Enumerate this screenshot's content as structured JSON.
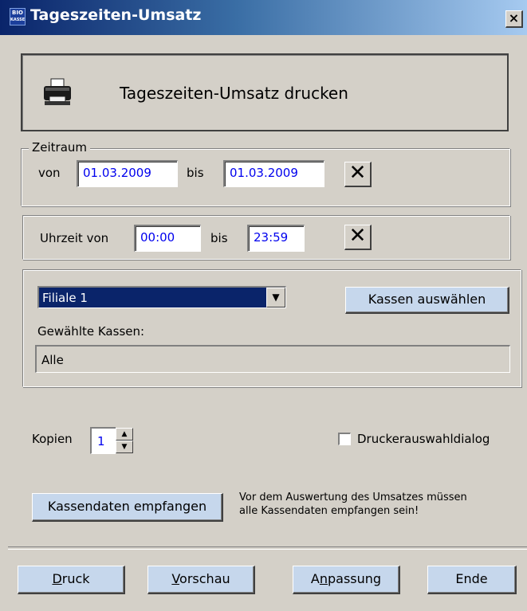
{
  "window": {
    "title": "Tageszeiten-Umsatz",
    "close_glyph": "×",
    "app_icon_text_top": "BIO",
    "app_icon_text_bottom": "KASSE"
  },
  "header": {
    "text": "Tageszeiten-Umsatz drucken",
    "icon": "printer-icon"
  },
  "zeitraum": {
    "legend": "Zeitraum",
    "von_label": "von",
    "von_value": "01.03.2009",
    "bis_label": "bis",
    "bis_value": "01.03.2009",
    "clear_glyph": "✕"
  },
  "uhrzeit": {
    "von_label": "Uhrzeit von",
    "von_value": "00:00",
    "bis_label": "bis",
    "bis_value": "23:59",
    "clear_glyph": "✕"
  },
  "filiale": {
    "selected": "Filiale 1",
    "dropdown_arrow": "▼",
    "kassen_button": "Kassen auswählen",
    "gewaehlte_label": "Gewählte Kassen:",
    "gewaehlte_value": "Alle"
  },
  "kopien": {
    "label": "Kopien",
    "value": "1",
    "up_glyph": "▲",
    "down_glyph": "▼"
  },
  "druckerauswahl": {
    "label": "Druckerauswahldialog",
    "checked": false
  },
  "kassendaten": {
    "button": "Kassendaten empfangen",
    "note_line1": "Vor dem Auswertung des Umsatzes müssen",
    "note_line2": "alle Kassendaten empfangen sein!"
  },
  "footer": {
    "druck_mnemonic": "D",
    "druck_rest": "ruck",
    "vorschau_mnemonic": "V",
    "vorschau_rest": "orschau",
    "anpassung_pre": "A",
    "anpassung_mnemonic": "n",
    "anpassung_rest": "passung",
    "ende": "Ende"
  },
  "colors": {
    "face": "#d4d0c8",
    "title_start": "#0a246a",
    "title_end": "#a6caf0",
    "field_text": "#0000ee",
    "blue_button": "#c6d7ec"
  }
}
